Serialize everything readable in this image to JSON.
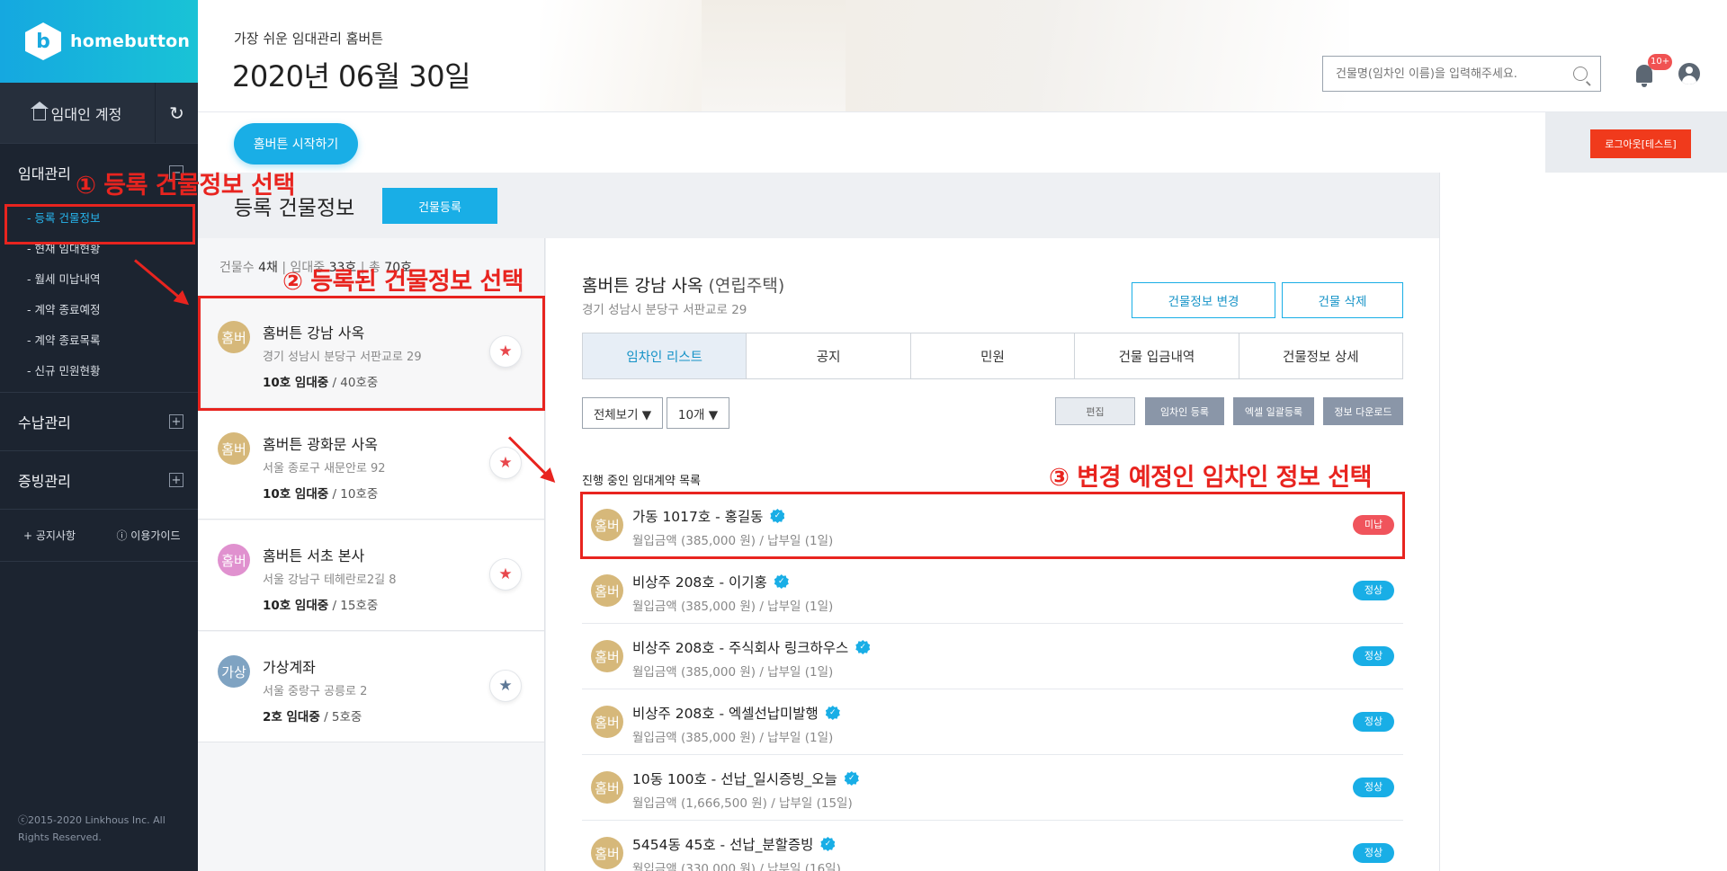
{
  "sidebar": {
    "logo_text": "homebutton",
    "logo_mark": "b",
    "account_label": "임대인 계정",
    "refresh_icon": "↻",
    "groups": [
      {
        "label": "임대관리",
        "toggle": "−"
      },
      {
        "label": "수납관리",
        "toggle": "+"
      },
      {
        "label": "증빙관리",
        "toggle": "+"
      }
    ],
    "sub_items": [
      {
        "label": "- 등록 건물정보"
      },
      {
        "label": "- 현재 임대현황"
      },
      {
        "label": "- 월세 미납내역"
      },
      {
        "label": "- 계약 종료예정"
      },
      {
        "label": "- 계약 종료목록"
      },
      {
        "label": "- 신규 민원현황"
      }
    ],
    "links": [
      {
        "label": "+ 공지사항"
      },
      {
        "label": "ⓘ 이용가이드"
      }
    ],
    "footer": "ⓒ2015-2020 Linkhous Inc. All Rights Reserved."
  },
  "header": {
    "subtitle": "가장 쉬운 임대관리 홈버튼",
    "date_title": "2020년 06월 30일",
    "search_placeholder": "건물명(임차인 이름)을 입력해주세요.",
    "bell_badge": "10+"
  },
  "topbar": {
    "start_label": "홈버튼 시작하기",
    "logout_label": "로그아웃[테스트]"
  },
  "page": {
    "title": "등록 건물정보",
    "register_label": "건물등록"
  },
  "building_stats": {
    "count_label": "건물수",
    "count_value": "4채",
    "rented_label": "임대중",
    "rented_value": "33호",
    "total_label": "총",
    "total_value": "70호"
  },
  "buildings": [
    {
      "avatar": "홈버",
      "name": "홈버튼 강남 사옥",
      "address": "경기 성남시 분당구 서판교로 29",
      "rented": "10호 임대중",
      "total": "/ 40호중",
      "avatar_color": "#d6b87a",
      "star_color": "#e8474c"
    },
    {
      "avatar": "홈버",
      "name": "홈버튼 광화문 사옥",
      "address": "서울 종로구 새문안로 92",
      "rented": "10호 임대중",
      "total": "/ 10호중",
      "avatar_color": "#d6b87a",
      "star_color": "#e8474c"
    },
    {
      "avatar": "홈버",
      "name": "홈버튼 서초 본사",
      "address": "서울 강남구 테헤란로2길 8",
      "rented": "10호 임대중",
      "total": "/ 15호중",
      "avatar_color": "#e091cf",
      "star_color": "#e8474c"
    },
    {
      "avatar": "가상",
      "name": "가상계좌",
      "address": "서울 중랑구 공릉로 2",
      "rented": "2호 임대중",
      "total": "/ 5호중",
      "avatar_color": "#7fa3c2",
      "star_color": "#5d7896"
    }
  ],
  "detail": {
    "title": "홈버튼 강남 사옥",
    "type": "(연립주택)",
    "address": "경기 성남시 분당구 서판교로 29",
    "edit_info_label": "건물정보 변경",
    "delete_label": "건물 삭제",
    "tabs": [
      {
        "label": "임차인 리스트"
      },
      {
        "label": "공지"
      },
      {
        "label": "민원"
      },
      {
        "label": "건물 입금내역"
      },
      {
        "label": "건물정보 상세"
      }
    ],
    "filter_label": "전체보기 ▼",
    "page_size_label": "10개 ▼",
    "action_buttons": [
      {
        "label": "편집"
      },
      {
        "label": "임차인 등록"
      },
      {
        "label": "엑셀 일괄등록"
      },
      {
        "label": "정보 다운로드"
      }
    ],
    "list_title": "진행 중인 임대계약 목록",
    "tenants": [
      {
        "avatar": "홈버",
        "name": "가동 1017호 - 홍길동",
        "info": "월입금액 (385,000 원) / 납부일 (1일)",
        "status": "미납",
        "status_color": "#f0545c"
      },
      {
        "avatar": "홈버",
        "name": "비상주 208호 - 이기홍",
        "info": "월입금액 (385,000 원) / 납부일 (1일)",
        "status": "정상",
        "status_color": "#19aee6"
      },
      {
        "avatar": "홈버",
        "name": "비상주 208호 - 주식회사 링크하우스",
        "info": "월입금액 (385,000 원) / 납부일 (1일)",
        "status": "정상",
        "status_color": "#19aee6"
      },
      {
        "avatar": "홈버",
        "name": "비상주 208호 - 엑셀선납미발행",
        "info": "월입금액 (385,000 원) / 납부일 (1일)",
        "status": "정상",
        "status_color": "#19aee6"
      },
      {
        "avatar": "홈버",
        "name": "10동 100호 - 선납_일시증빙_오늘",
        "info": "월입금액 (1,666,500 원) / 납부일 (15일)",
        "status": "정상",
        "status_color": "#19aee6"
      },
      {
        "avatar": "홈버",
        "name": "5454동 45호 - 선납_분할증빙",
        "info": "월입금액 (330,000 원) / 납부일 (16일)",
        "status": "정상",
        "status_color": "#19aee6"
      }
    ]
  },
  "annotations": [
    {
      "text": "① 등록 건물정보 선택"
    },
    {
      "text": "② 등록된 건물정보 선택"
    },
    {
      "text": "③ 변경 예정인 임차인 정보 선택"
    }
  ],
  "colors": {
    "accent": "#19aee6",
    "sidebar_bg": "#1c2430",
    "annotation": "#e8241f",
    "logout": "#f03a1c"
  }
}
